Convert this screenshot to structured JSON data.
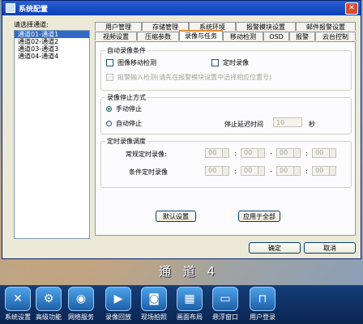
{
  "window": {
    "title": "系统配置",
    "close_glyph": "✕"
  },
  "channels": {
    "label": "请选择通道:",
    "items": [
      "通道01-通道1",
      "通道02-通道2",
      "通道03-通道3",
      "通道04-通道4"
    ],
    "selected_index": 0
  },
  "tabs": {
    "row1": [
      "用户管理",
      "存储管理",
      "系统环境",
      "报警模块设置",
      "邮件报警设置"
    ],
    "row2": [
      "视频设置",
      "压缩参数",
      "录像与任务",
      "移动检测",
      "OSD",
      "报警",
      "云台控制"
    ],
    "active": "录像与任务"
  },
  "auto_record": {
    "title": "自动录像条件",
    "motion_detect": "图像移动检测",
    "timed_record": "定时录像",
    "alarm_input": "报警输入检测(请先在报警模块设置中选择相应位置号)"
  },
  "stop_mode": {
    "title": "录像停止方式",
    "manual": "手动停止",
    "auto": "自动停止",
    "delay_label": "停止延迟时间",
    "delay_value": "10",
    "delay_unit": "秒"
  },
  "schedule": {
    "title": "定时录像调度",
    "normal_label": "常规定时录像:",
    "conditional_label": "条件定时录像",
    "normal_times": [
      "00",
      "00",
      "00",
      "00"
    ],
    "conditional_times": [
      "00",
      "00",
      "00",
      "00"
    ]
  },
  "buttons": {
    "default": "默认设置",
    "apply_all": "应用于全部",
    "ok": "确定",
    "cancel": "取消"
  },
  "overlay": {
    "channel_name": "通 道 4"
  },
  "taskbar": [
    {
      "label": "系统设置",
      "icon": "tools-icon",
      "glyph": "✕"
    },
    {
      "label": "高级功能",
      "icon": "gears-icon",
      "glyph": "⚙"
    },
    {
      "label": "网络服务",
      "icon": "globe-icon",
      "glyph": "◉"
    },
    {
      "label": "录像回放",
      "icon": "film-icon",
      "glyph": "▶"
    },
    {
      "label": "现场拍照",
      "icon": "camera-icon",
      "glyph": "◙"
    },
    {
      "label": "画面布局",
      "icon": "layout-icon",
      "glyph": "▦"
    },
    {
      "label": "悬浮窗口",
      "icon": "window-icon",
      "glyph": "▭"
    },
    {
      "label": "用户登录",
      "icon": "lock-icon",
      "glyph": "⊓"
    }
  ]
}
